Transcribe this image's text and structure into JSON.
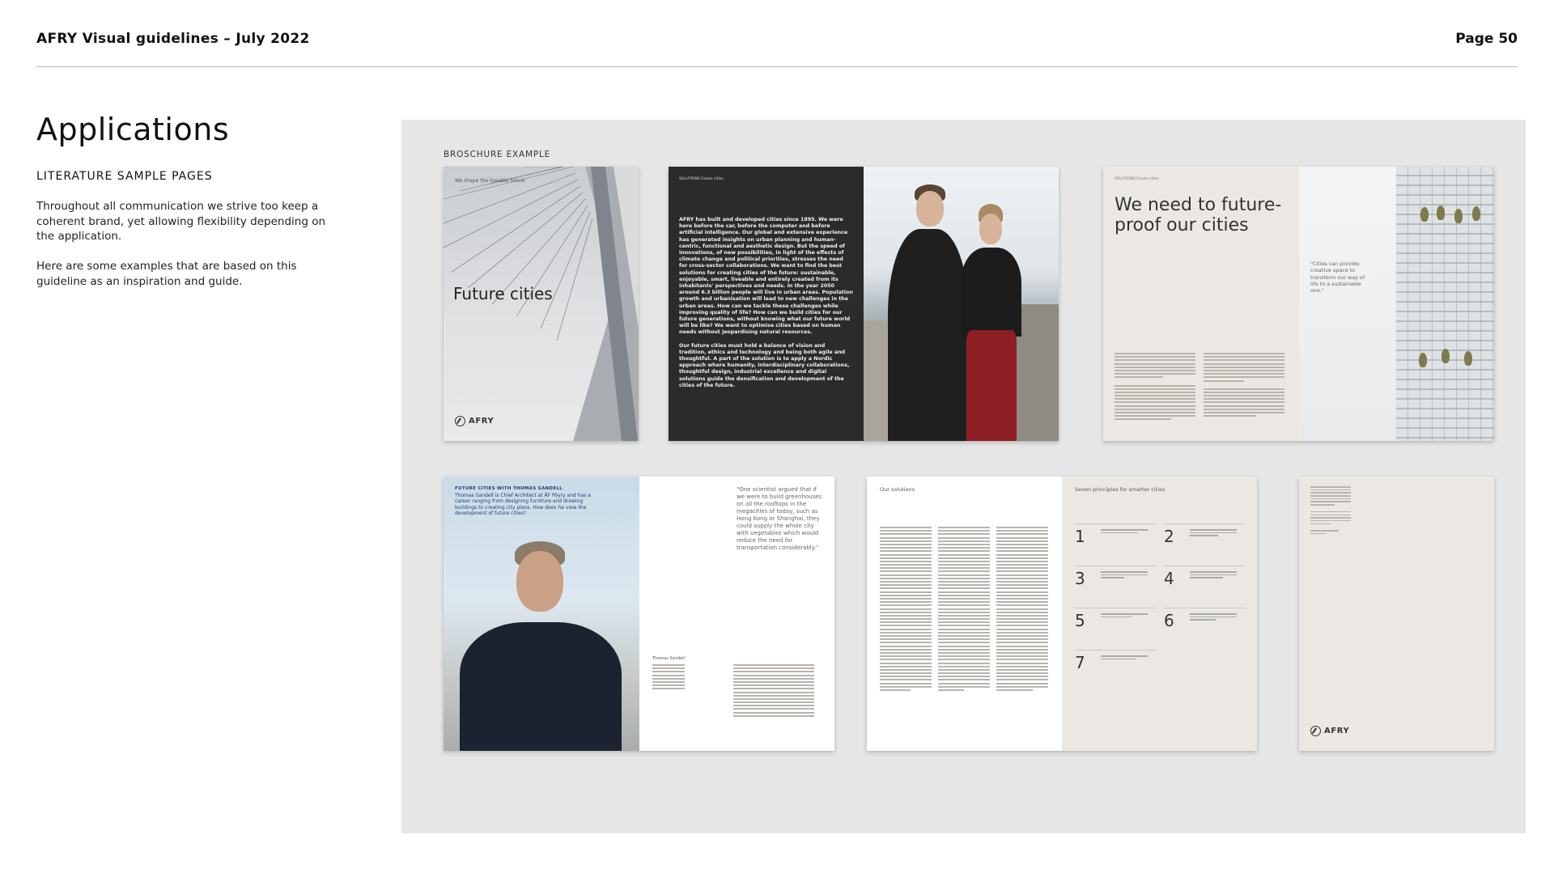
{
  "header": {
    "doc_title": "AFRY Visual guidelines – July 2022",
    "page_label": "Page 50"
  },
  "main": {
    "title": "Applications",
    "subtitle": "LITERATURE SAMPLE PAGES",
    "paragraph1": "Throughout all communication we strive too keep a coherent brand, yet allowing flexibility depending on the application.",
    "paragraph2": "Here are some examples that are based on this guideline as an inspiration and guide."
  },
  "panel": {
    "label": "BROSCHURE EXAMPLE",
    "cover": {
      "tagline": "We shape the liveable future",
      "title": "Future cities",
      "logo_text": "AFRY"
    },
    "spread2": {
      "header": "SOLUTIONS Future cities",
      "paragraph1": "AFRY has built and developed cities since 1895. We were here before the car, before the computer and before artificial intelligence. Our global and extensive experience has generated insights on urban planning and human-centric, functional and aesthetic design. But the speed of innovations, of new possibilities, in light of the effects of climate change and political priorities, stresses the need for cross-sector collaborations. We want to find the best solutions for creating cities of the future: sustainable, enjoyable, smart, liveable and entirely created from its inhabitants' perspectives and needs. In the year 2050 around 6.3 billion people will live in urban areas. Population growth and urbanisation will lead to new challenges in the urban areas. How can we tackle these challenges while improving quality of life? How can we build cities for our future generations, without knowing what our future world will be like? We want to optimise cities based on human needs without jeopardising natural resources.",
      "paragraph2": "Our future cities must hold a balance of vision and tradition, ethics and technology and being both agile and thoughtful. A part of the solution is to apply a Nordic approach where humanity, interdisciplinary collaborations, thoughtful design, industrial excellence and digital solutions guide the densification and development of the cities of the future."
    },
    "spread3": {
      "header": "SOLUTIONS Future cities",
      "headline": "We need to future-proof our cities",
      "quote": "\"Cities can provide creative space to transform our way of life to a sustainable one.\""
    },
    "spread4": {
      "kicker": "FUTURE CITIES WITH THOMAS SANDELL",
      "intro": "Thomas Sandell is Chief Architect at ÅF Pöyry and has a career ranging from designing furniture and drawing buildings to creating city plans. How does he view the development of future cities?",
      "quote": "\"One scientist argued that if we were to build greenhouses on all the rooftops in the megacities of today, such as Hong Kong or Shanghai, they could supply the whole city with vegetables which would reduce the need for transportation considerably.\"",
      "name": "Thomas Sandell"
    },
    "spread5": {
      "left_title": "Our solutions",
      "right_title": "Seven principles for smarter cities",
      "numbers": [
        "1",
        "2",
        "3",
        "4",
        "5",
        "6",
        "7"
      ]
    },
    "back_cover": {
      "logo_text": "AFRY"
    }
  }
}
